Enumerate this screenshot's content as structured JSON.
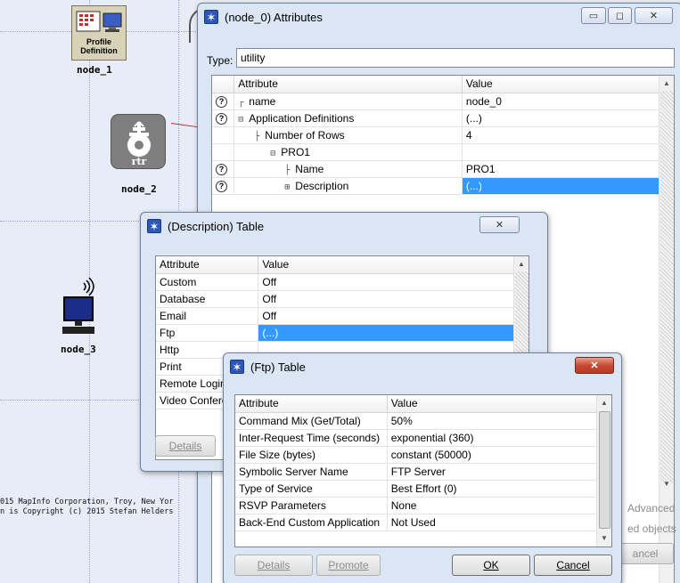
{
  "workspace": {
    "nodes": [
      {
        "label": "node_1",
        "icon_caption_1": "Profile",
        "icon_caption_2": "Definition"
      },
      {
        "label": "node_2",
        "icon_caption": "rtr"
      },
      {
        "label": "node_3"
      }
    ],
    "copyright_line_1": "015 MapInfo Corporation, Troy, New Yor",
    "copyright_line_2": "n is Copyright (c) 2015 Stefan Helders"
  },
  "attributes_window": {
    "title": "(node_0) Attributes",
    "type_label": "Type:",
    "type_value": "utility",
    "columns": [
      "Attribute",
      "Value"
    ],
    "rows": [
      {
        "attribute": "name",
        "value": "node_0",
        "help": true
      },
      {
        "attribute": "Application Definitions",
        "value": "(...)",
        "help": true
      },
      {
        "attribute": "Number of Rows",
        "value": "4",
        "help": false
      },
      {
        "attribute": "PRO1",
        "value": "",
        "help": false
      },
      {
        "attribute": "Name",
        "value": "PRO1",
        "help": true
      },
      {
        "attribute": "Description",
        "value": "(...)",
        "help": true
      }
    ],
    "right_labels": [
      "Advanced",
      "ed objects"
    ],
    "cancel_partial": "ancel"
  },
  "description_window": {
    "title": "(Description) Table",
    "columns": [
      "Attribute",
      "Value"
    ],
    "rows": [
      {
        "attribute": "Custom",
        "value": "Off"
      },
      {
        "attribute": "Database",
        "value": "Off"
      },
      {
        "attribute": "Email",
        "value": "Off"
      },
      {
        "attribute": "Ftp",
        "value": "(...)"
      },
      {
        "attribute": "Http",
        "value": ""
      },
      {
        "attribute": "Print",
        "value": ""
      },
      {
        "attribute": "Remote Login",
        "value": ""
      },
      {
        "attribute": "Video Conferencing",
        "value": ""
      }
    ],
    "details_label": "Details"
  },
  "ftp_window": {
    "title": "(Ftp) Table",
    "columns": [
      "Attribute",
      "Value"
    ],
    "rows": [
      {
        "attribute": "Command Mix (Get/Total)",
        "value": "50%"
      },
      {
        "attribute": "Inter-Request Time (seconds)",
        "value": "exponential (360)"
      },
      {
        "attribute": "File Size (bytes)",
        "value": "constant (50000)"
      },
      {
        "attribute": "Symbolic Server Name",
        "value": "FTP Server"
      },
      {
        "attribute": "Type of Service",
        "value": "Best Effort (0)"
      },
      {
        "attribute": "RSVP Parameters",
        "value": "None"
      },
      {
        "attribute": "Back-End Custom Application",
        "value": "Not Used"
      }
    ],
    "buttons": {
      "details": "Details",
      "promote": "Promote",
      "ok": "OK",
      "cancel": "Cancel"
    }
  },
  "colors": {
    "selection": "#3399ff",
    "window_frame": "#dbe6f4",
    "workspace": "#e8ecf6"
  }
}
